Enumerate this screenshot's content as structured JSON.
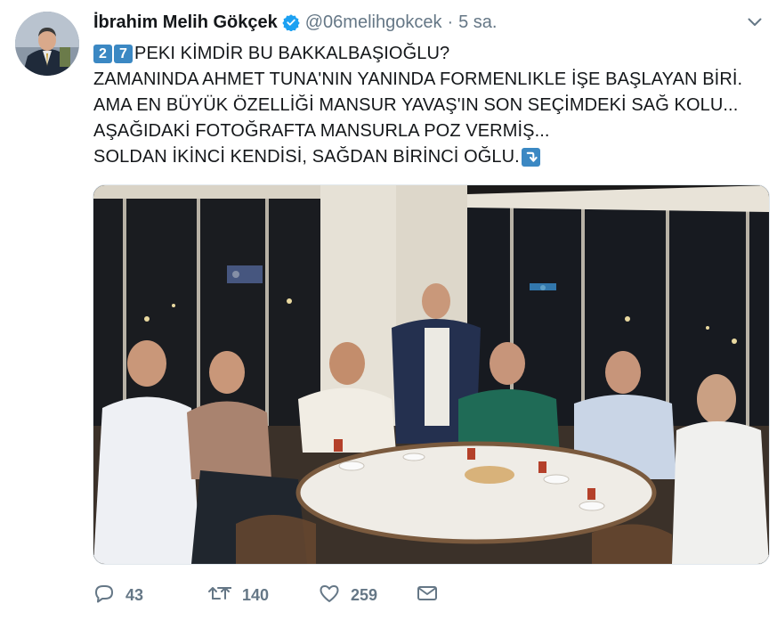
{
  "tweet": {
    "author_name": "İbrahim Melih Gökçek",
    "handle": "@06melihgokcek",
    "separator": "·",
    "time": "5 sa.",
    "verified_icon": "verified-badge-icon",
    "keycap_1": "2",
    "keycap_2": "7",
    "lines": [
      "PEKI KİMDİR BU BAKKALBAŞIOĞLU?",
      "ZAMANINDA AHMET TUNA'NIN YANINDA FORMENLIKLE İŞE BAŞLAYAN BİRİ.",
      "AMA EN BÜYÜK ÖZELLİĞİ MANSUR YAVAŞ'IN SON SEÇİMDEKİ SAĞ KOLU...",
      "AŞAĞIDAKİ FOTOĞRAFTA MANSURLA POZ VERMİŞ...",
      "SOLDAN İKİNCİ KENDİSİ, SAĞDAN BİRİNCİ OĞLU."
    ],
    "arrow_icon": "arrow-down-right-emoji-icon"
  },
  "actions": {
    "reply_count": "43",
    "retweet_count": "140",
    "like_count": "259"
  },
  "colors": {
    "text": "#14171a",
    "muted": "#657786",
    "verified": "#1da1f2",
    "keycap": "#3b88c3"
  }
}
